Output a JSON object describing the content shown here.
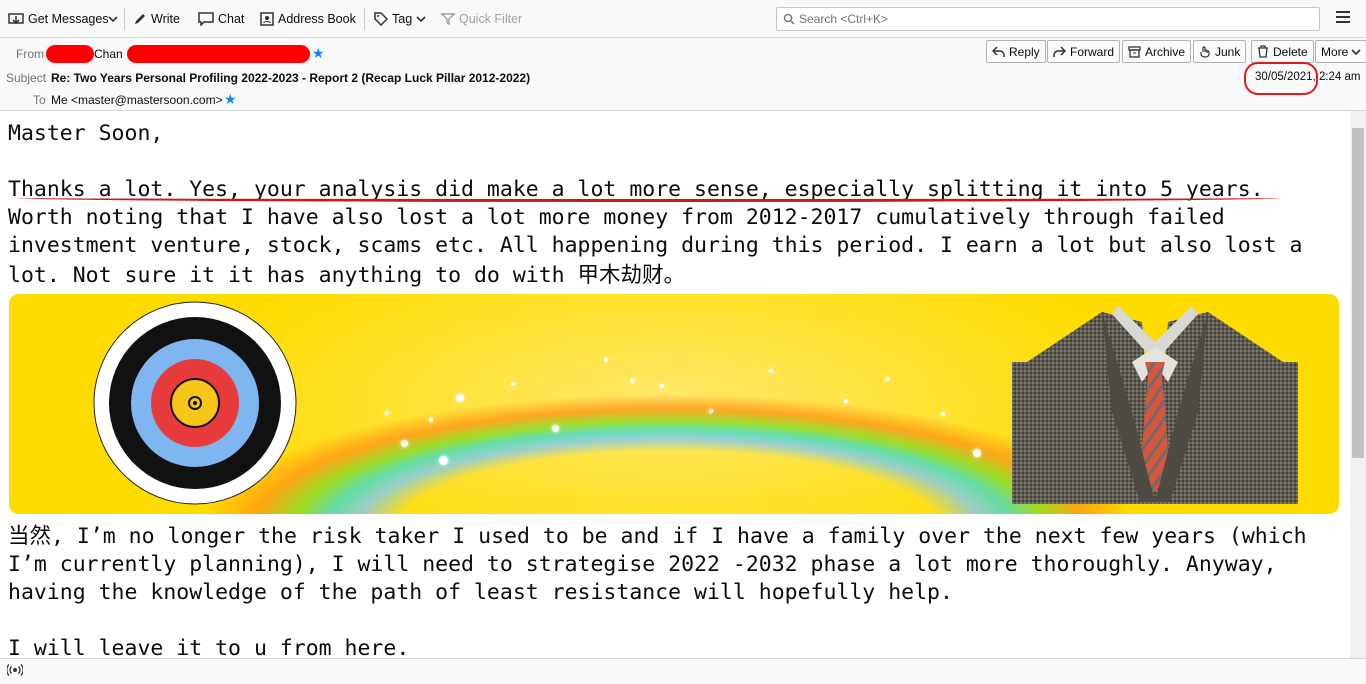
{
  "toolbar": {
    "get_messages": "Get Messages",
    "write": "Write",
    "chat": "Chat",
    "address_book": "Address Book",
    "tag": "Tag",
    "quick_filter": "Quick Filter",
    "search_placeholder": "Search <Ctrl+K>"
  },
  "header": {
    "from_label": "From",
    "from_name_visible": "Chan",
    "subject_label": "Subject",
    "subject": "Re: Two Years Personal Profiling 2022-2023 - Report 2   (Recap Luck Pillar 2012-2022)",
    "to_label": "To",
    "to_value": "Me <master@mastersoon.com>",
    "date": "30/05/2021, 2:24 am",
    "actions": {
      "reply": "Reply",
      "forward": "Forward",
      "archive": "Archive",
      "junk": "Junk",
      "delete": "Delete",
      "more": "More"
    }
  },
  "message": {
    "greeting": "Master Soon,",
    "line1": "Thanks a lot. Yes, your analysis did make a lot more sense, especially splitting it into 5 years.",
    "line2": "Worth noting that I have also lost a lot more money from 2012-2017 cumulatively through failed",
    "line3": "investment venture, stock, scams etc. All happening during this period. I earn a lot but also lost a",
    "line4": "lot. Not sure it it has anything to do with 甲木劫财。",
    "line5": "当然, I’m no longer the risk taker I used to be and if I have a family over the next few years (which",
    "line6": "I’m currently planning), I will need to strategise 2022 -2032 phase a lot more thoroughly. Anyway,",
    "line7": "having the knowledge of the path of least resistance will hopefully help.",
    "line8": "I will leave it to u from here."
  },
  "colors": {
    "annotation_red": "#e0191a",
    "banner_yellow": "#ffd800",
    "star_blue": "#0a84ff"
  }
}
